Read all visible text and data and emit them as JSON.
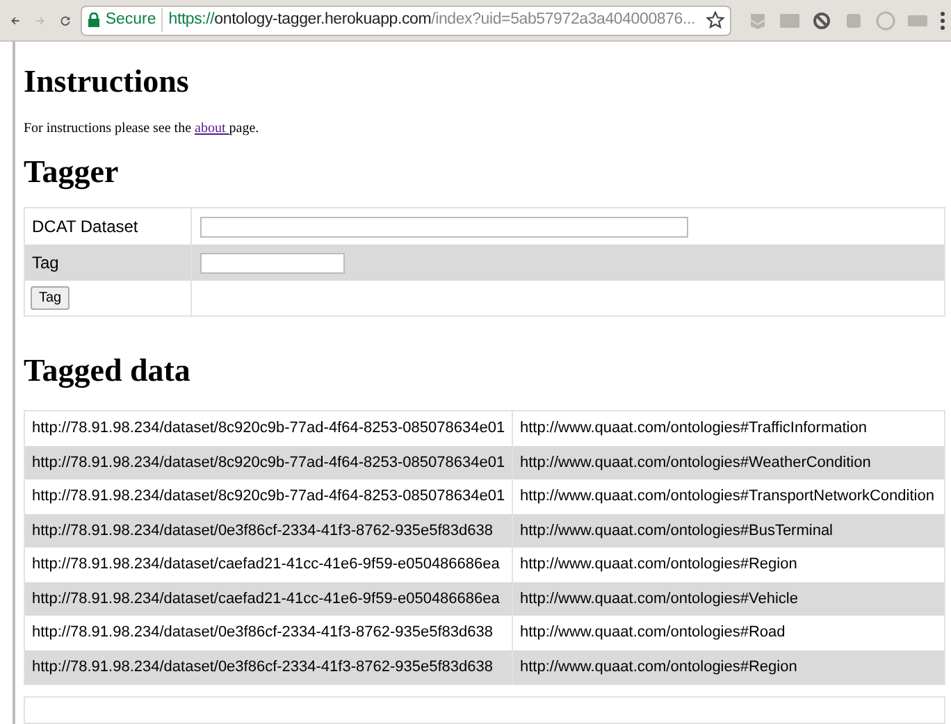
{
  "browser": {
    "security_label": "Secure",
    "url": {
      "scheme": "https://",
      "host": "ontology-tagger.herokuapp.com",
      "path": "/index?uid=5ab57972a3a404000876..."
    }
  },
  "instructions": {
    "heading": "Instructions",
    "text_before": "For instructions please see the",
    "link": "about ",
    "text_after": "page."
  },
  "tagger": {
    "heading": "Tagger",
    "fields": [
      {
        "label": "DCAT Dataset",
        "kind": "wide"
      },
      {
        "label": "Tag",
        "kind": "short"
      }
    ],
    "button": "Tag"
  },
  "tagged_data": {
    "heading": "Tagged data",
    "rows": [
      [
        "http://78.91.98.234/dataset/8c920c9b-77ad-4f64-8253-085078634e01",
        "http://www.quaat.com/ontologies#TrafficInformation"
      ],
      [
        "http://78.91.98.234/dataset/8c920c9b-77ad-4f64-8253-085078634e01",
        "http://www.quaat.com/ontologies#WeatherCondition"
      ],
      [
        "http://78.91.98.234/dataset/8c920c9b-77ad-4f64-8253-085078634e01",
        "http://www.quaat.com/ontologies#TransportNetworkCondition"
      ],
      [
        "http://78.91.98.234/dataset/0e3f86cf-2334-41f3-8762-935e5f83d638",
        "http://www.quaat.com/ontologies#BusTerminal"
      ],
      [
        "http://78.91.98.234/dataset/caefad21-41cc-41e6-9f59-e050486686ea",
        "http://www.quaat.com/ontologies#Region"
      ],
      [
        "http://78.91.98.234/dataset/caefad21-41cc-41e6-9f59-e050486686ea",
        "http://www.quaat.com/ontologies#Vehicle"
      ],
      [
        "http://78.91.98.234/dataset/0e3f86cf-2334-41f3-8762-935e5f83d638",
        "http://www.quaat.com/ontologies#Road"
      ],
      [
        "http://78.91.98.234/dataset/0e3f86cf-2334-41f3-8762-935e5f83d638",
        "http://www.quaat.com/ontologies#Region"
      ]
    ]
  }
}
